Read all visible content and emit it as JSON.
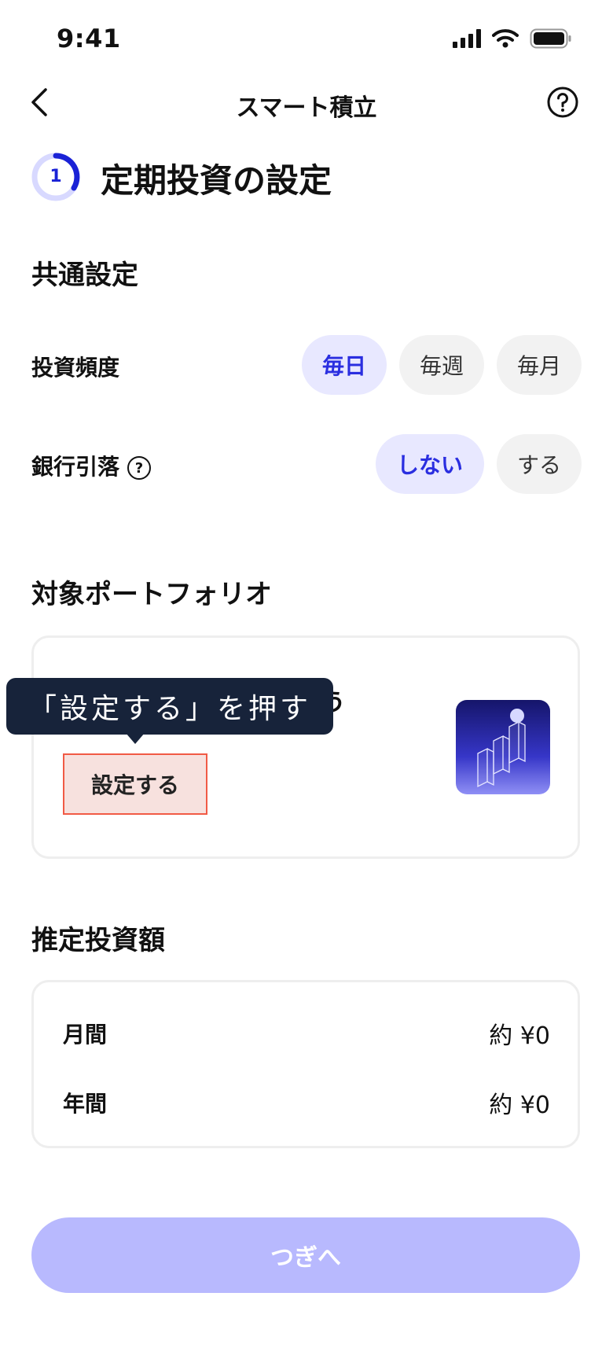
{
  "status_bar": {
    "time": "9:41"
  },
  "header": {
    "title": "スマート積立"
  },
  "step": {
    "number": "1",
    "title": "定期投資の設定"
  },
  "common": {
    "title": "共通設定",
    "frequency": {
      "label": "投資頻度",
      "options": [
        "毎日",
        "毎週",
        "毎月"
      ],
      "selected": "毎日"
    },
    "bank_debit": {
      "label": "銀行引落",
      "options": [
        "しない",
        "する"
      ],
      "selected": "しない"
    }
  },
  "portfolio": {
    "title": "対象ポートフォリオ",
    "tooltip": "「設定する」を押す",
    "partial_text": "う",
    "button": "設定する"
  },
  "estimate": {
    "title": "推定投資額",
    "rows": [
      {
        "label": "月間",
        "value": "約 ¥0"
      },
      {
        "label": "年間",
        "value": "約 ¥0"
      }
    ]
  },
  "next_button": "つぎへ",
  "colors": {
    "accent": "#2a2ee0",
    "selected_bg": "#e8e8ff",
    "next_disabled": "#b8b9fe",
    "tooltip_bg": "#17233a",
    "highlight_border": "#f15a45"
  }
}
